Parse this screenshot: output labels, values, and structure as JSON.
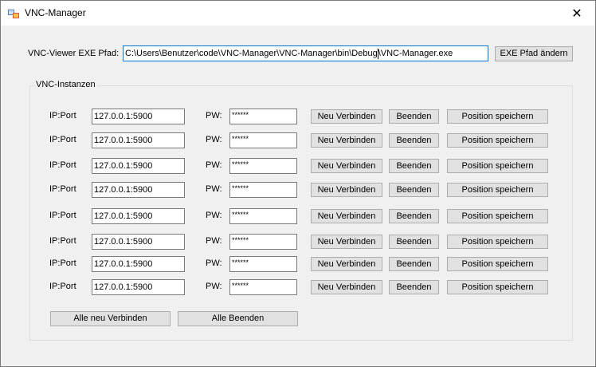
{
  "window": {
    "title": "VNC-Manager"
  },
  "path": {
    "label": "VNC-Viewer EXE Pfad:",
    "value_before_caret": "C:\\Users\\Benutzer\\code\\VNC-Manager\\VNC-Manager\\bin\\Debug",
    "value_after_caret": "\\VNC-Manager.exe",
    "change_button": "EXE Pfad ändern"
  },
  "group": {
    "title": "VNC-Instanzen"
  },
  "instances": [
    {
      "ip_label": "IP:Port",
      "ip": "127.0.0.1:5900",
      "pw_label": "PW:",
      "pw": "******",
      "connect": "Neu Verbinden",
      "stop": "Beenden",
      "save": "Position speichern"
    },
    {
      "ip_label": "IP:Port",
      "ip": "127.0.0.1:5900",
      "pw_label": "PW:",
      "pw": "******",
      "connect": "Neu Verbinden",
      "stop": "Beenden",
      "save": "Position speichern"
    },
    {
      "ip_label": "IP:Port",
      "ip": "127.0.0.1:5900",
      "pw_label": "PW:",
      "pw": "******",
      "connect": "Neu Verbinden",
      "stop": "Beenden",
      "save": "Position speichern"
    },
    {
      "ip_label": "IP:Port",
      "ip": "127.0.0.1:5900",
      "pw_label": "PW:",
      "pw": "******",
      "connect": "Neu Verbinden",
      "stop": "Beenden",
      "save": "Position speichern"
    },
    {
      "ip_label": "IP:Port",
      "ip": "127.0.0.1:5900",
      "pw_label": "PW:",
      "pw": "******",
      "connect": "Neu Verbinden",
      "stop": "Beenden",
      "save": "Position speichern"
    },
    {
      "ip_label": "IP:Port",
      "ip": "127.0.0.1:5900",
      "pw_label": "PW:",
      "pw": "******",
      "connect": "Neu Verbinden",
      "stop": "Beenden",
      "save": "Position speichern"
    },
    {
      "ip_label": "IP:Port",
      "ip": "127.0.0.1:5900",
      "pw_label": "PW:",
      "pw": "******",
      "connect": "Neu Verbinden",
      "stop": "Beenden",
      "save": "Position speichern"
    },
    {
      "ip_label": "IP:Port",
      "ip": "127.0.0.1:5900",
      "pw_label": "PW:",
      "pw": "******",
      "connect": "Neu Verbinden",
      "stop": "Beenden",
      "save": "Position speichern"
    }
  ],
  "footer": {
    "reconnect_all": "Alle neu Verbinden",
    "stop_all": "Alle Beenden"
  }
}
